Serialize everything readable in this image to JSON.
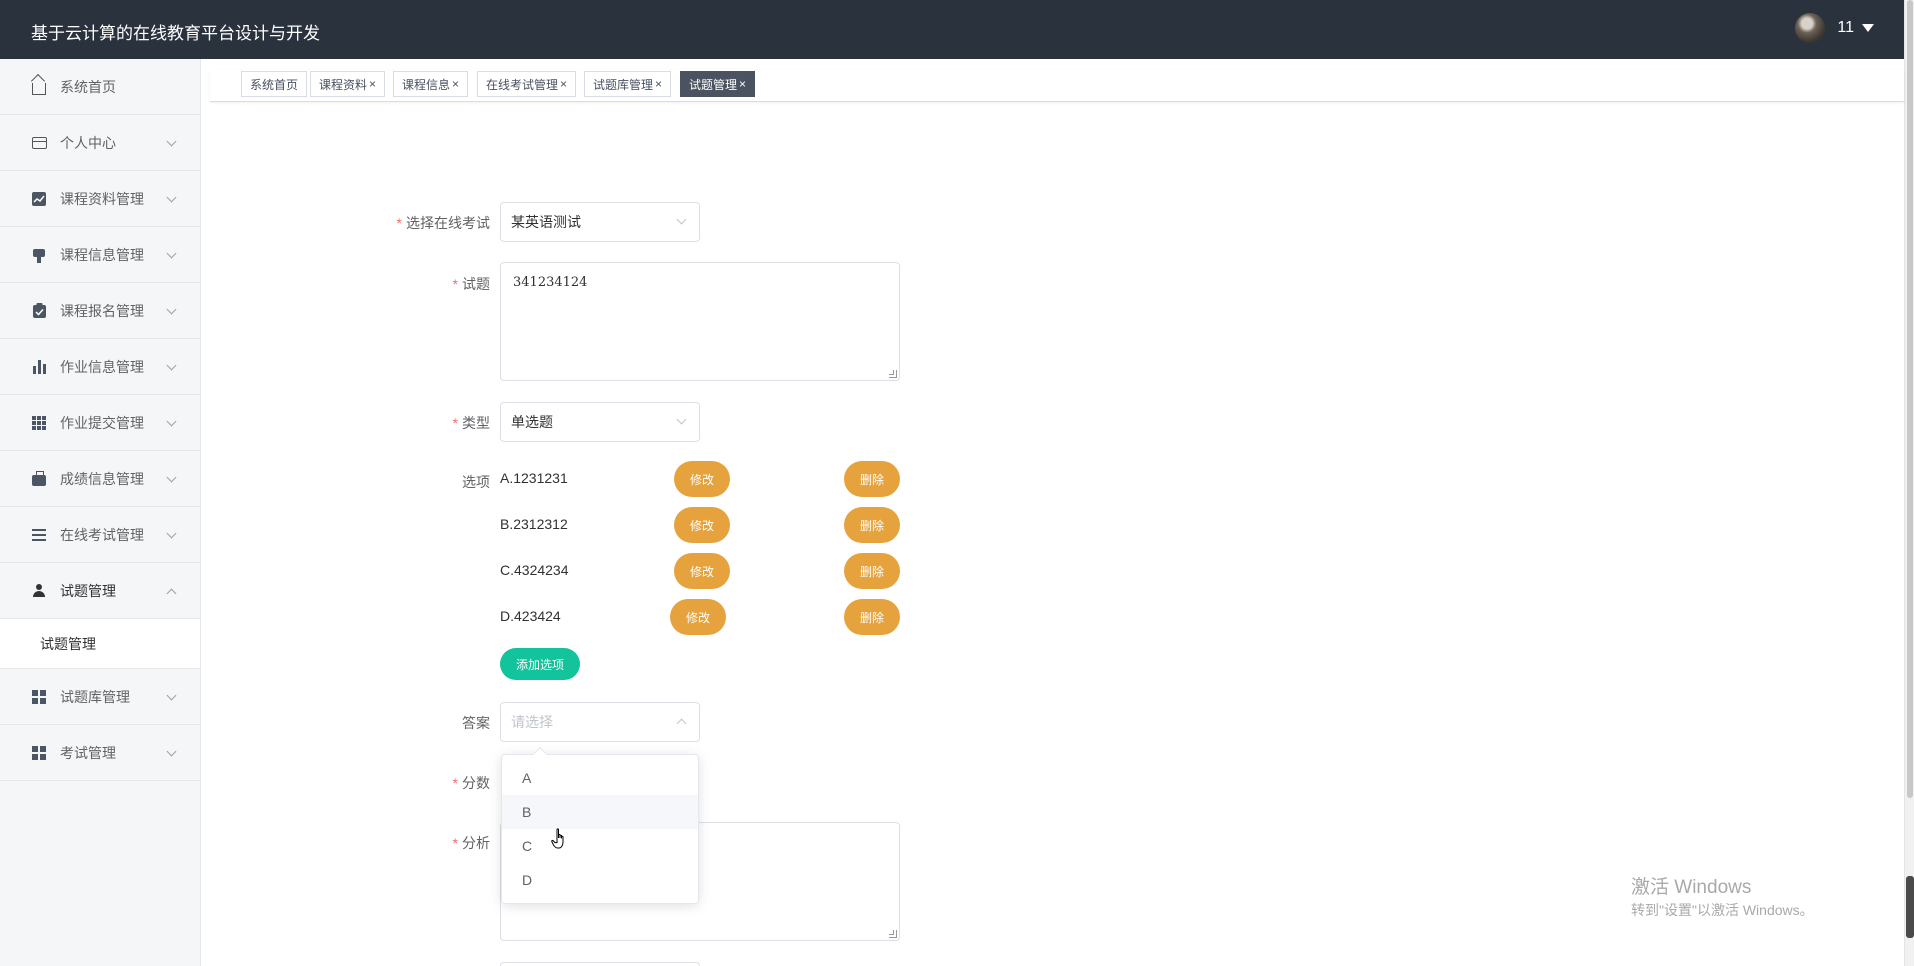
{
  "header": {
    "title": "基于云计算的在线教育平台设计与开发",
    "user_name": "11"
  },
  "sidebar": {
    "items": [
      {
        "label": "系统首页",
        "icon": "home-icon"
      },
      {
        "label": "个人中心",
        "icon": "card-icon"
      },
      {
        "label": "课程资料管理",
        "icon": "chart-icon"
      },
      {
        "label": "课程信息管理",
        "icon": "pin-icon"
      },
      {
        "label": "课程报名管理",
        "icon": "clipboard-icon"
      },
      {
        "label": "作业信息管理",
        "icon": "bar-chart-icon"
      },
      {
        "label": "作业提交管理",
        "icon": "grid-icon"
      },
      {
        "label": "成绩信息管理",
        "icon": "briefcase-icon"
      },
      {
        "label": "在线考试管理",
        "icon": "list-icon"
      },
      {
        "label": "试题管理",
        "icon": "user-icon"
      },
      {
        "label": "试题库管理",
        "icon": "apps-icon"
      },
      {
        "label": "考试管理",
        "icon": "apps-icon"
      }
    ],
    "submenu_item": "试题管理"
  },
  "tabs": [
    {
      "label": "系统首页"
    },
    {
      "label": "课程资料"
    },
    {
      "label": "课程信息"
    },
    {
      "label": "在线考试管理"
    },
    {
      "label": "试题库管理"
    },
    {
      "label": "试题管理"
    }
  ],
  "tab_close_glyph": "×",
  "form": {
    "required_mark": "*",
    "exam_label": "选择在线考试",
    "exam_value": "某英语测试",
    "question_label": "试题",
    "question_value": "341234124",
    "type_label": "类型",
    "type_value": "单选题",
    "options_label": "选项",
    "options": [
      {
        "text": "A.1231231",
        "edit": "修改",
        "delete": "删除"
      },
      {
        "text": "B.2312312",
        "edit": "修改",
        "delete": "删除"
      },
      {
        "text": "C.4324234",
        "edit": "修改",
        "delete": "删除"
      },
      {
        "text": "D.423424",
        "edit": "修改",
        "delete": "删除"
      }
    ],
    "add_option": "添加选项",
    "answer_label": "答案",
    "answer_placeholder": "请选择",
    "score_label": "分数",
    "analysis_label": "分析"
  },
  "answer_dropdown": {
    "options": [
      "A",
      "B",
      "C",
      "D"
    ],
    "hovered": "B"
  },
  "watermark": {
    "title": "激活 Windows",
    "subtitle": "转到\"设置\"以激活 Windows。"
  },
  "colors": {
    "header_bg": "#2a323d",
    "warning_button": "#e6a23c",
    "success_button": "#13c39c",
    "active_tab": "#4a535f",
    "required": "#f56c6c"
  }
}
